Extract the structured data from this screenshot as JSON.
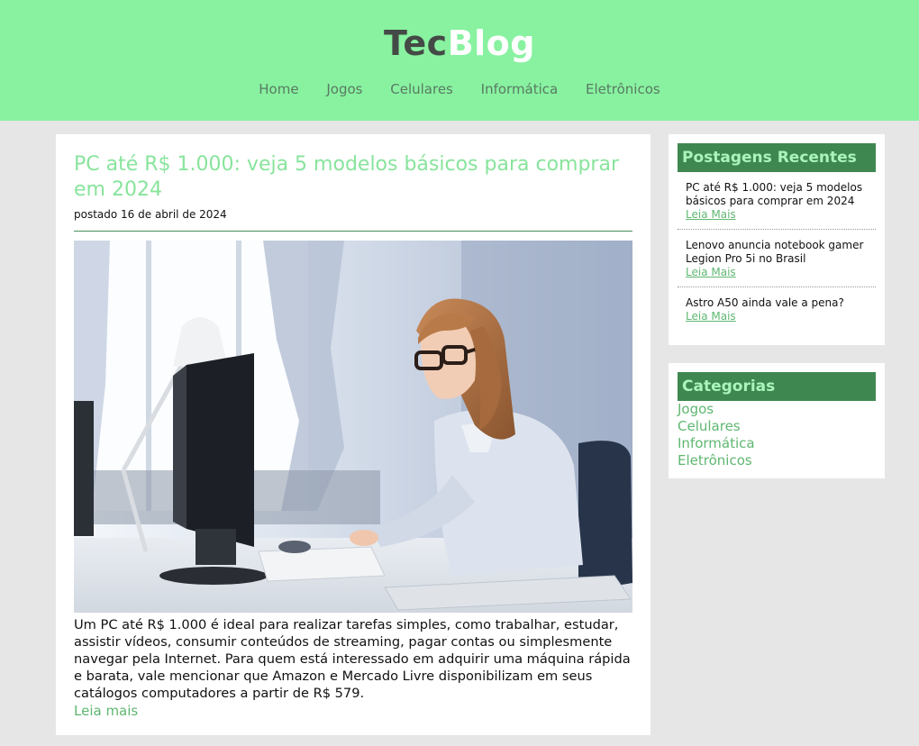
{
  "header": {
    "logo_part1": "Tec",
    "logo_part2": "Blog",
    "nav": [
      "Home",
      "Jogos",
      "Celulares",
      "Informática",
      "Eletrônicos"
    ]
  },
  "post": {
    "title": "PC até R$ 1.000: veja 5 modelos básicos para comprar em 2024",
    "meta": "postado 16 de abril de 2024",
    "image_alt": "woman-working-at-desktop-computer",
    "body": "Um PC até R$ 1.000 é ideal para realizar tarefas simples, como trabalhar, estudar, assistir vídeos, consumir conteúdos de streaming, pagar contas ou simplesmente navegar pela Internet. Para quem está interessado em adquirir uma máquina rápida e barata, vale mencionar que Amazon e Mercado Livre disponibilizam em seus catálogos computadores a partir de R$ 579.",
    "read_more": "Leia mais"
  },
  "sidebar": {
    "recent_title": "Postagens Recentes",
    "recent": [
      {
        "title": "PC até R$ 1.000: veja 5 modelos básicos para comprar em 2024",
        "link": "Leia Mais"
      },
      {
        "title": "Lenovo anuncia notebook gamer Legion Pro 5i no Brasil",
        "link": "Leia Mais"
      },
      {
        "title": "Astro A50 ainda vale a pena?",
        "link": "Leia Mais"
      }
    ],
    "categories_title": "Categorias",
    "categories": [
      "Jogos",
      "Celulares",
      "Informática",
      "Eletrônicos"
    ]
  },
  "colors": {
    "header_bg": "#88f2a0",
    "accent_green": "#3f8751",
    "link_green": "#5fb771",
    "title_green": "#88e49c",
    "page_bg": "#e6e6e6"
  }
}
